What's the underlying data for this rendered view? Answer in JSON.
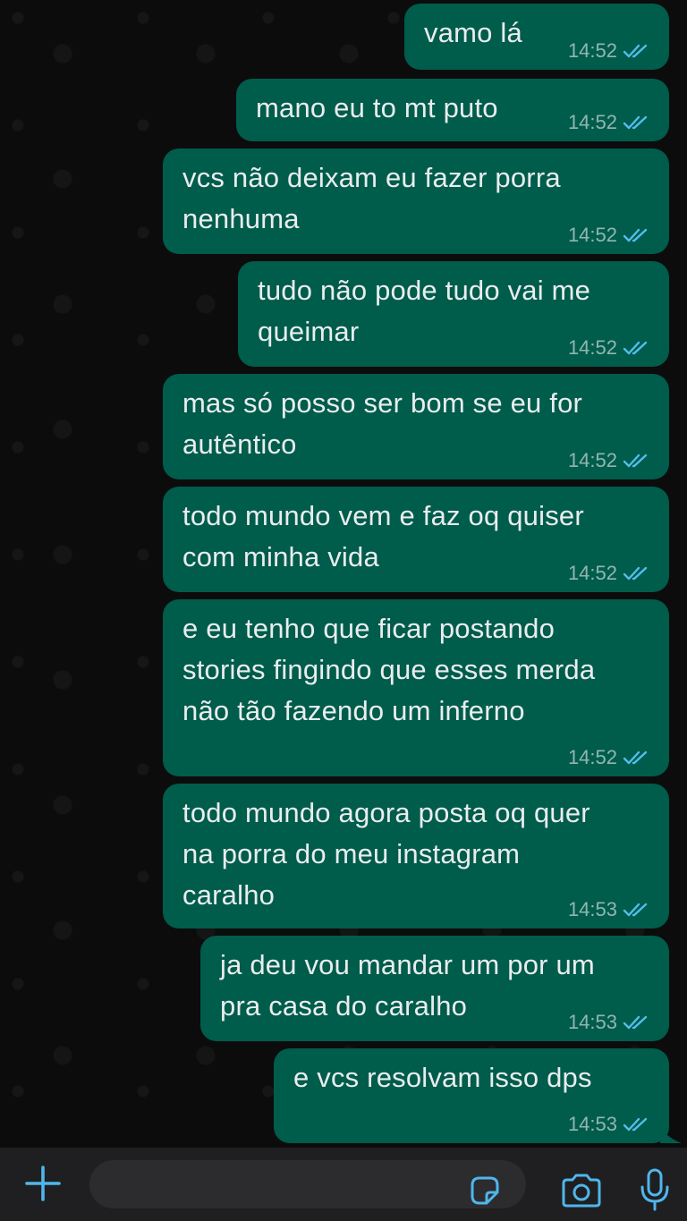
{
  "chat": {
    "messages": [
      {
        "text": "vamo lá",
        "time": "14:52"
      },
      {
        "text": "mano eu to mt puto",
        "time": "14:52"
      },
      {
        "text": "vcs não deixam eu fazer porra\nnenhuma",
        "time": "14:52"
      },
      {
        "text": "tudo não pode tudo vai me\nqueimar",
        "time": "14:52"
      },
      {
        "text": "mas só posso ser bom se eu for\nautêntico",
        "time": "14:52"
      },
      {
        "text": "todo mundo vem e faz oq quiser\ncom minha vida",
        "time": "14:52"
      },
      {
        "text": "e eu tenho que ficar postando\nstories fingindo que esses merda\nnão tão fazendo um inferno",
        "time": "14:52"
      },
      {
        "text": "todo mundo agora posta oq quer\nna porra do meu instagram\ncaralho",
        "time": "14:53"
      },
      {
        "text": "ja deu vou mandar um por um\npra casa do caralho",
        "time": "14:53"
      },
      {
        "text": "e vcs resolvam isso dps",
        "time": "14:53"
      }
    ],
    "read_status": "read",
    "colors": {
      "bubble": "#005c4b",
      "read_ticks": "#53bdeb",
      "accent_icons": "#4fb6ec"
    }
  },
  "input_bar": {
    "icons": [
      "plus-icon",
      "sticker-icon",
      "camera-icon",
      "microphone-icon"
    ]
  }
}
